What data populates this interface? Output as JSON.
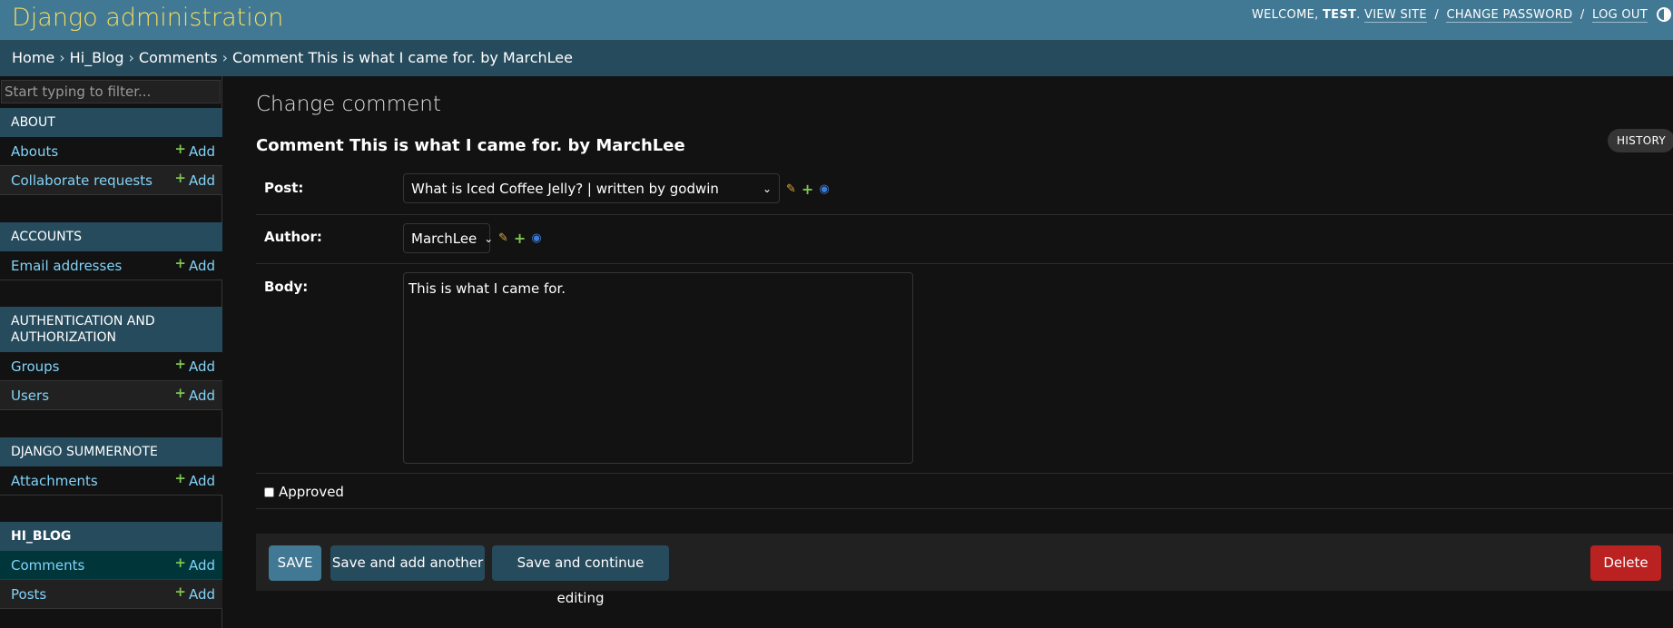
{
  "header": {
    "branding": "Django administration",
    "welcome": "Welcome,",
    "username": "test",
    "view_site": "View site",
    "change_password": "Change password",
    "log_out": "Log out",
    "separator": "/"
  },
  "breadcrumbs": {
    "items": [
      "Home",
      "Hi_Blog",
      "Comments",
      "Comment This is what I came for. by MarchLee"
    ],
    "separator": "›"
  },
  "sidebar": {
    "filter_placeholder": "Start typing to filter...",
    "add_label": "Add",
    "apps": [
      {
        "name": "About",
        "models": [
          "Abouts",
          "Collaborate requests"
        ]
      },
      {
        "name": "Accounts",
        "models": [
          "Email addresses"
        ]
      },
      {
        "name": "Authentication and Authorization",
        "models": [
          "Groups",
          "Users"
        ]
      },
      {
        "name": "Django Summernote",
        "models": [
          "Attachments"
        ]
      },
      {
        "name": "Hi_Blog",
        "models": [
          "Comments",
          "Posts"
        ]
      }
    ]
  },
  "content": {
    "page_title": "Change comment",
    "object_title": "Comment This is what I came for. by MarchLee",
    "history_label": "History",
    "fields": {
      "post_label": "Post:",
      "post_value": "What is Iced Coffee Jelly? | written by godwin",
      "author_label": "Author:",
      "author_value": "MarchLee",
      "body_label": "Body:",
      "body_value": "This is what I came for.",
      "approved_label": "Approved"
    },
    "buttons": {
      "save": "Save",
      "save_add": "Save and add another",
      "save_continue": "Save and continue editing",
      "delete": "Delete"
    }
  },
  "colors": {
    "header_bg": "#417893",
    "breadcrumb_bg": "#264b5d",
    "branding": "#f5dd5d",
    "link": "#81d4fa",
    "add_plus": "#7ec550",
    "delete": "#ba2121"
  }
}
